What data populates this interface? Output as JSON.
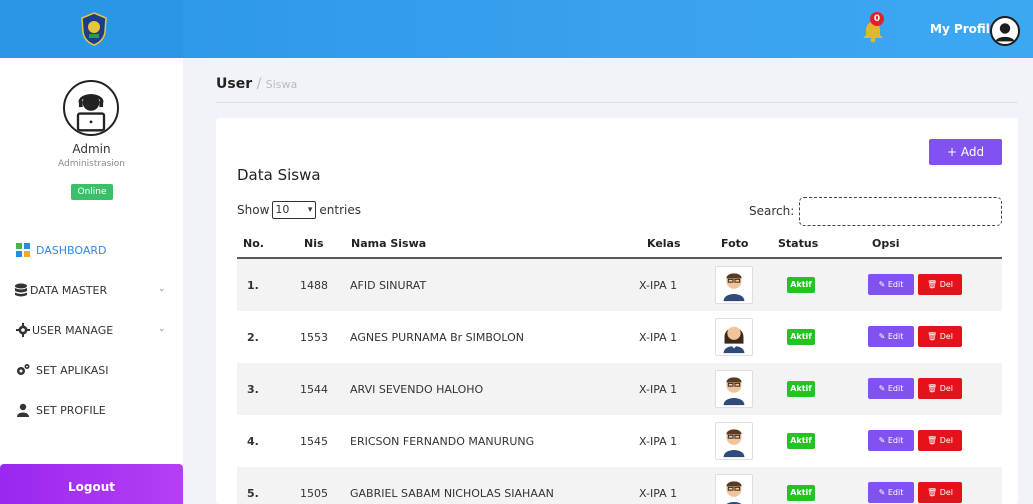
{
  "topbar": {
    "profile_label": "My Profile",
    "notification_count": "0",
    "colors": {
      "primary": "#2a96e6",
      "badge": "#e0222a"
    }
  },
  "sidebar": {
    "user_name": "Admin",
    "user_role": "Administrasion",
    "status": "Online",
    "items": [
      {
        "label": "DASHBOARD",
        "icon": "dashboard-icon",
        "active": true
      },
      {
        "label": "DATA MASTER",
        "icon": "database-icon",
        "expandable": true
      },
      {
        "label": "USER MANAGE",
        "icon": "gear-icon",
        "expandable": true
      },
      {
        "label": "SET APLIKASI",
        "icon": "gears-icon"
      },
      {
        "label": "SET PROFILE",
        "icon": "user-icon"
      }
    ],
    "logout_label": "Logout"
  },
  "breadcrumb": {
    "current": "User",
    "separator": "/",
    "sub": "Siswa"
  },
  "card": {
    "add_label": "Add",
    "title": "Data Siswa",
    "show_prefix": "Show",
    "show_value": "10",
    "show_suffix": "entries",
    "search_label": "Search:",
    "search_value": ""
  },
  "table": {
    "headers": {
      "no": "No.",
      "nis": "Nis",
      "nama": "Nama Siswa",
      "kelas": "Kelas",
      "foto": "Foto",
      "status": "Status",
      "opsi": "Opsi"
    },
    "edit_label": "Edit",
    "del_label": "Del",
    "rows": [
      {
        "no": "1.",
        "nis": "1488",
        "nama": "AFID SINURAT",
        "kelas": "X-IPA 1",
        "status": "Aktif",
        "photo": "boy"
      },
      {
        "no": "2.",
        "nis": "1553",
        "nama": "AGNES PURNAMA Br SIMBOLON",
        "kelas": "X-IPA 1",
        "status": "Aktif",
        "photo": "girl"
      },
      {
        "no": "3.",
        "nis": "1544",
        "nama": "ARVI SEVENDO HALOHO",
        "kelas": "X-IPA 1",
        "status": "Aktif",
        "photo": "boy"
      },
      {
        "no": "4.",
        "nis": "1545",
        "nama": "ERICSON FERNANDO MANURUNG",
        "kelas": "X-IPA 1",
        "status": "Aktif",
        "photo": "boy"
      },
      {
        "no": "5.",
        "nis": "1505",
        "nama": "GABRIEL SABAM NICHOLAS SIAHAAN",
        "kelas": "X-IPA 1",
        "status": "Aktif",
        "photo": "boy"
      }
    ]
  }
}
